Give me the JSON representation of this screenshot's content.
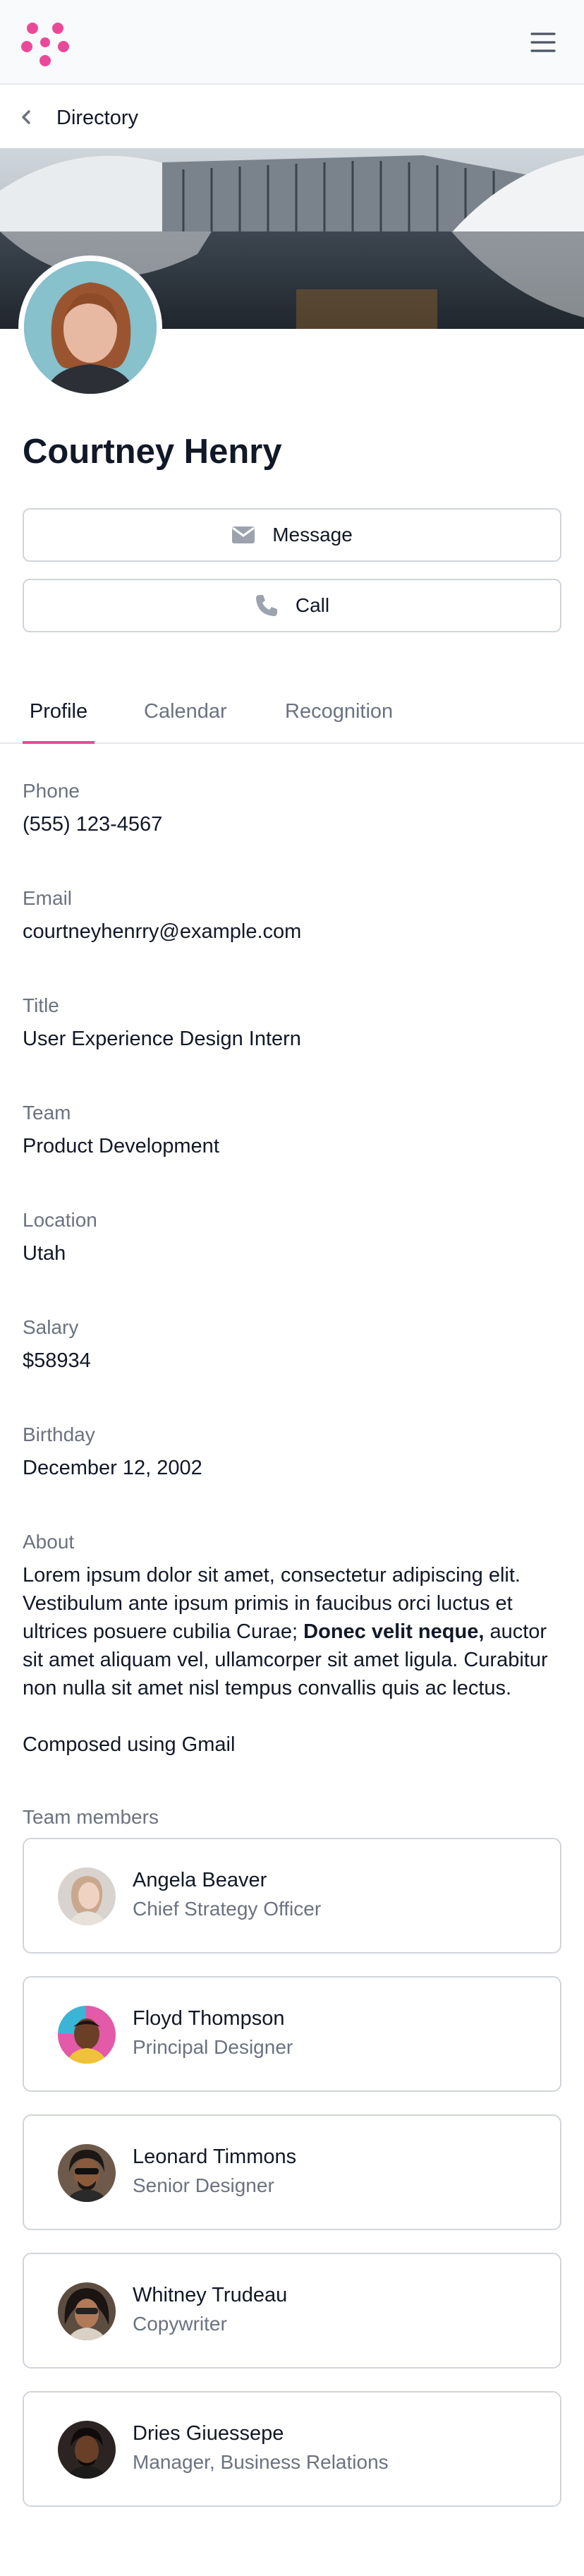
{
  "header": {
    "logo_icon": "flower-logo-icon",
    "menu_icon": "hamburger-menu-icon"
  },
  "breadcrumb": {
    "label": "Directory",
    "icon": "chevron-left-icon"
  },
  "profile": {
    "name": "Courtney Henry",
    "message_label": "Message",
    "call_label": "Call"
  },
  "tabs": [
    {
      "label": "Profile",
      "active": true
    },
    {
      "label": "Calendar",
      "active": false
    },
    {
      "label": "Recognition",
      "active": false
    }
  ],
  "fields": [
    {
      "label": "Phone",
      "value": "(555) 123-4567"
    },
    {
      "label": "Email",
      "value": "courtneyhenrry@example.com"
    },
    {
      "label": "Title",
      "value": "User Experience Design Intern"
    },
    {
      "label": "Team",
      "value": "Product Development"
    },
    {
      "label": "Location",
      "value": "Utah"
    },
    {
      "label": "Salary",
      "value": "$58934"
    },
    {
      "label": "Birthday",
      "value": "December 12, 2002"
    }
  ],
  "about": {
    "label": "About",
    "text_before_bold": "Lorem ipsum dolor sit amet, consectetur adipiscing elit. Vestibulum ante ipsum primis in faucibus orci luctus et ultrices posuere cubilia Curae; ",
    "bold": "Donec velit neque,",
    "text_after_bold": " auctor sit amet aliquam vel, ullamcorper sit amet ligula. Curabitur non nulla sit amet nisl tempus convallis quis ac lectus.",
    "second_paragraph": "Composed using Gmail"
  },
  "team": {
    "label": "Team members",
    "members": [
      {
        "name": "Angela Beaver",
        "role": "Chief Strategy Officer"
      },
      {
        "name": "Floyd Thompson",
        "role": "Principal Designer"
      },
      {
        "name": "Leonard Timmons",
        "role": "Senior Designer"
      },
      {
        "name": "Whitney Trudeau",
        "role": "Copywriter"
      },
      {
        "name": "Dries Giuessepe",
        "role": "Manager, Business Relations"
      }
    ]
  },
  "colors": {
    "accent": "#ec4899",
    "muted": "#6b7280",
    "border": "#d1d5db"
  }
}
